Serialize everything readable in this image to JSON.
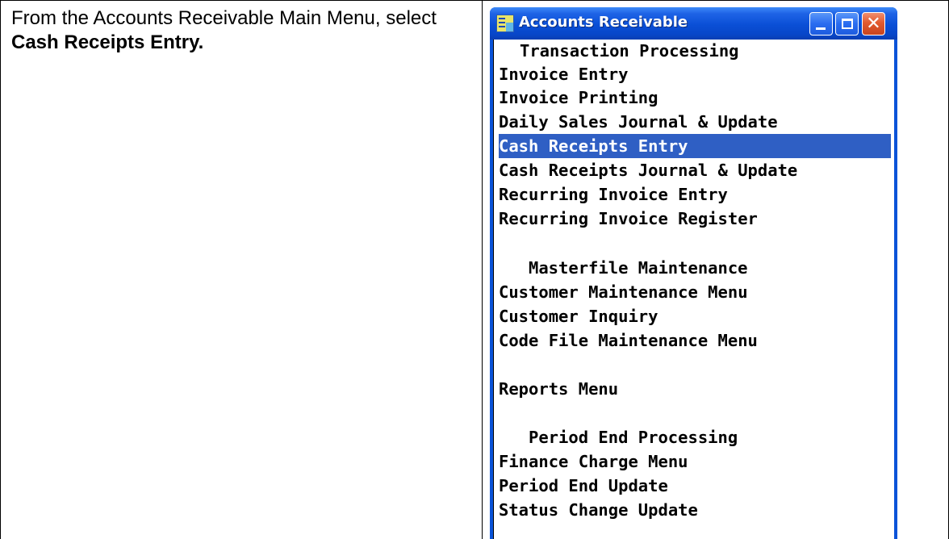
{
  "instruction": {
    "prefix": "From the Accounts Receivable Main Menu, select ",
    "bold": "Cash Receipts Entry."
  },
  "window": {
    "title": "Accounts Receivable",
    "icon": "app-icon",
    "buttons": {
      "minimize": "minimize-icon",
      "maximize": "maximize-icon",
      "close": "close-icon"
    }
  },
  "menu": {
    "heading_transaction": "Transaction Processing",
    "invoice_entry": "Invoice Entry",
    "invoice_printing": "Invoice Printing",
    "daily_sales": "Daily Sales Journal & Update",
    "cash_receipts_entry": "Cash Receipts Entry",
    "cash_receipts_journal": "Cash Receipts Journal & Update",
    "recurring_invoice_entry": "Recurring Invoice Entry",
    "recurring_invoice_register": "Recurring Invoice Register",
    "heading_masterfile": "Masterfile Maintenance",
    "customer_maintenance": "Customer Maintenance Menu",
    "customer_inquiry": "Customer Inquiry",
    "code_file_maintenance": "Code File Maintenance Menu",
    "reports_menu": "Reports Menu",
    "heading_period_end": "Period End Processing",
    "finance_charge": "Finance Charge Menu",
    "period_end_update": "Period End Update",
    "status_change_update": "Status Change Update",
    "selected_item": "Cash Receipts Entry"
  },
  "colors": {
    "selection": "#2f5fc4",
    "titlebar": "#0a4fd6",
    "close_button": "#e35a2f"
  }
}
